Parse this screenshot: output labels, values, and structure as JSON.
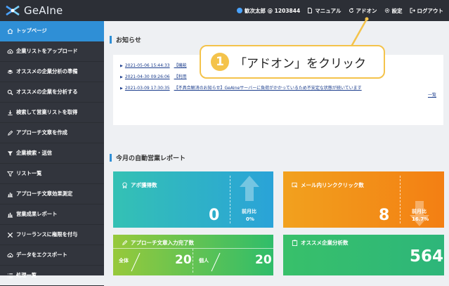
{
  "app": {
    "logo_text": "GeAIne"
  },
  "topbar": {
    "user": "歓次太郎 @ 1203844",
    "manual": "マニュアル",
    "addon": "アドオン",
    "settings": "設定",
    "logout": "ログアウト"
  },
  "sidebar": {
    "items": [
      {
        "label": "トップページ",
        "icon": "home-icon",
        "active": true
      },
      {
        "label": "企業リストをアップロード",
        "icon": "cloud-upload-icon"
      },
      {
        "label": "オススメの企業分析の準備",
        "icon": "layers-icon"
      },
      {
        "label": "オススメの企業を分析する",
        "icon": "search-icon"
      },
      {
        "label": "検索して営業リストを取得",
        "icon": "download-icon"
      },
      {
        "label": "アプローチ文章を作成",
        "icon": "pencil-icon"
      },
      {
        "label": "企業検索・送信",
        "icon": "filter-icon"
      },
      {
        "label": "リスト一覧",
        "icon": "filter-list-icon"
      },
      {
        "label": "アプローチ文章効果測定",
        "icon": "bar-chart-icon"
      },
      {
        "label": "営業成果レポート",
        "icon": "bar-chart-icon"
      },
      {
        "label": "フリーランスに権限を付与",
        "icon": "tools-icon"
      },
      {
        "label": "データをエクスポート",
        "icon": "cloud-download-icon"
      },
      {
        "label": "処理一覧",
        "icon": "list-icon"
      }
    ]
  },
  "news": {
    "title": "お知らせ",
    "items": [
      {
        "date": "2021-05-06 15:44:33",
        "text": "【機能"
      },
      {
        "date": "2021-04-30 09:26:06",
        "text": "【利用"
      },
      {
        "date": "2021-03-09 17:30:35",
        "text": "【不具合解消のお知らせ】GeAIneサーバーに負荷がかかっているため不安定な状態が続いています"
      }
    ],
    "more": "一覧"
  },
  "callout": {
    "number": "1",
    "text": "「アドオン」をクリック"
  },
  "report": {
    "title": "今月の自動営業レポート",
    "tiles": {
      "appointments": {
        "label": "アポ獲得数",
        "value": "0",
        "cmp_label": "前月比",
        "cmp_value": "0%"
      },
      "link_clicks": {
        "label": "メール内リンククリック数",
        "value": "8",
        "cmp_label": "前月比",
        "cmp_value": "16.7%"
      },
      "approach_inputs": {
        "label": "アプローチ文章入力完了数",
        "all_label": "全体",
        "all_value": "20",
        "individual_label": "個人",
        "individual_value": "20"
      },
      "recommended": {
        "label": "オススメ企業分析数",
        "value": "564"
      }
    }
  },
  "colors": {
    "accent": "#2f8fd6",
    "callout": "#f4c34b",
    "sidebar": "#32353d",
    "topbar": "#2c2f36"
  }
}
